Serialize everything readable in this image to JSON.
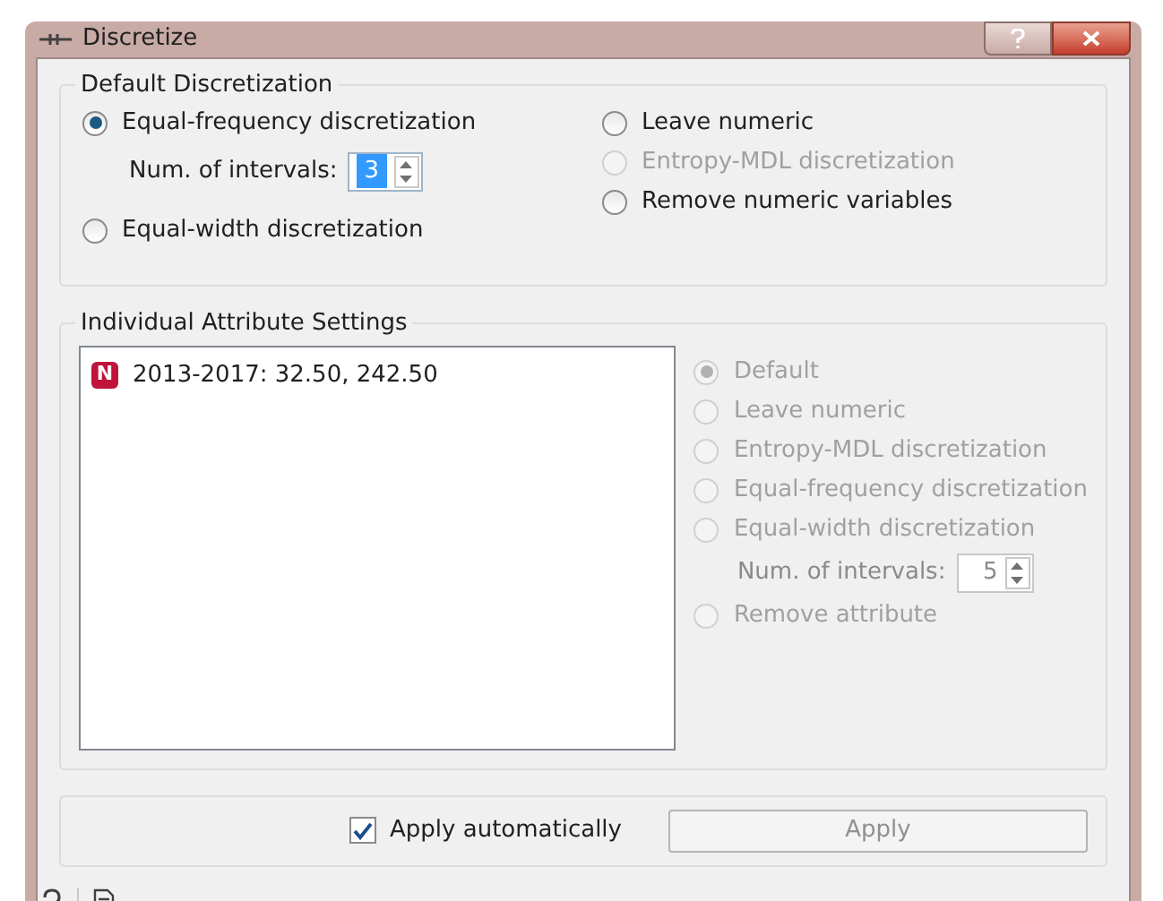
{
  "window": {
    "title": "Discretize"
  },
  "default_discretization": {
    "title": "Default Discretization",
    "left_options": [
      {
        "label": "Equal-frequency discretization",
        "selected": true,
        "disabled": false
      },
      {
        "label": "Equal-width discretization",
        "selected": false,
        "disabled": false
      }
    ],
    "intervals": {
      "label": "Num. of intervals:",
      "value": "3",
      "disabled": false
    },
    "right_options": [
      {
        "label": "Leave numeric",
        "selected": false,
        "disabled": false
      },
      {
        "label": "Entropy-MDL discretization",
        "selected": false,
        "disabled": true
      },
      {
        "label": "Remove numeric variables",
        "selected": false,
        "disabled": false
      }
    ]
  },
  "individual_settings": {
    "title": "Individual Attribute Settings",
    "attributes": [
      {
        "badge": "N",
        "label": "2013-2017: 32.50, 242.50",
        "color": "#c0143c"
      }
    ],
    "options": [
      {
        "label": "Default",
        "selected": true,
        "disabled": true
      },
      {
        "label": "Leave numeric",
        "selected": false,
        "disabled": true
      },
      {
        "label": "Entropy-MDL discretization",
        "selected": false,
        "disabled": true
      },
      {
        "label": "Equal-frequency discretization",
        "selected": false,
        "disabled": true
      },
      {
        "label": "Equal-width discretization",
        "selected": false,
        "disabled": true
      },
      {
        "label": "Remove attribute",
        "selected": false,
        "disabled": true
      }
    ],
    "intervals": {
      "label": "Num. of intervals:",
      "value": "5",
      "disabled": true
    }
  },
  "apply_automatically": {
    "label": "Apply automatically",
    "checked": true
  },
  "apply_button": {
    "label": "Apply",
    "disabled": true
  }
}
